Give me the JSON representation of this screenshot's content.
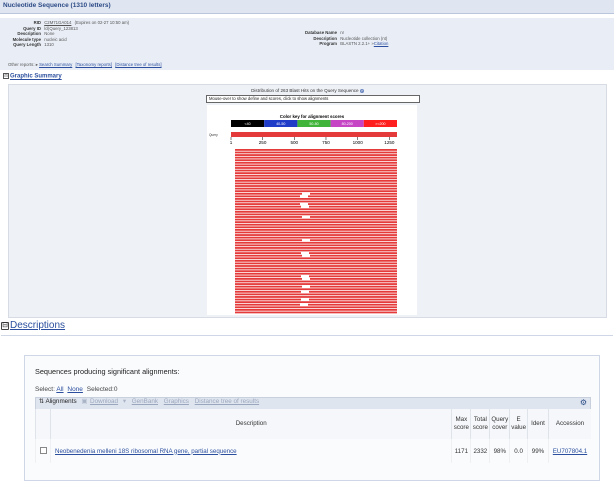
{
  "header": {
    "title": "Nucleotide Sequence (1310 letters)"
  },
  "info_left": [
    {
      "key": "RID",
      "value": "C2M71GA014",
      "value_suffix": "(Expires on 02-27 10:50 am)"
    },
    {
      "key": "Query ID",
      "value": "lcl|Query_123813"
    },
    {
      "key": "Description",
      "value": "None"
    },
    {
      "key": "Molecule type",
      "value": "nucleic acid"
    },
    {
      "key": "Query Length",
      "value": "1310"
    }
  ],
  "info_right": [
    {
      "key": "Database Name",
      "value": "nr"
    },
    {
      "key": "Description",
      "value": "Nucleotide collection (nt)"
    },
    {
      "key": "Program",
      "value": "BLASTN 2.2.1+",
      "value_link": "Citation"
    }
  ],
  "other_reports": {
    "label": "Other reports:",
    "links": [
      "Search Summary",
      "[Taxonomy reports]",
      "[Distance tree of results]"
    ]
  },
  "graphic_summary": {
    "toggle": "⊟",
    "label": "Graphic Summary",
    "distribution_title": "Distribution of 263 Blast Hits on the Query Sequence",
    "mouse_hint": "Mouse-over to show define and scores, click to show alignments",
    "color_key_title": "Color key for alignment scores",
    "color_key": [
      {
        "label": "<40",
        "color": "#000000"
      },
      {
        "label": "40-50",
        "color": "#1f3cc9"
      },
      {
        "label": "50-80",
        "color": "#3fb33a"
      },
      {
        "label": "80-200",
        "color": "#c545c5"
      },
      {
        "label": ">=200",
        "color": "#ff1f1f"
      }
    ],
    "query_label": "Query",
    "axis_ticks": [
      "1",
      "250",
      "500",
      "750",
      "1000",
      "1250"
    ],
    "hit_color": "#e53a3a"
  },
  "descriptions": {
    "toggle": "⊟",
    "label": "Descriptions",
    "heading": "Sequences producing significant alignments:",
    "select_label": "Select:",
    "select_all": "All",
    "select_none": "None",
    "selected": "Selected:0",
    "toolbar": {
      "alignments": "Alignments",
      "download": "Download",
      "genbank": "GenBank",
      "graphics": "Graphics",
      "distance_tree": "Distance tree of results"
    },
    "columns": {
      "description": "Description",
      "max_score": "Max score",
      "total_score": "Total score",
      "query_cover": "Query cover",
      "e_value": "E value",
      "ident": "Ident",
      "accession": "Accession"
    },
    "rows": [
      {
        "description": "Neobenedenia melleni 18S ribosomal RNA gene, partial sequence",
        "max_score": "1171",
        "total_score": "2332",
        "query_cover": "98%",
        "e_value": "0.0",
        "ident": "99%",
        "accession": "EU707804.1"
      }
    ]
  }
}
